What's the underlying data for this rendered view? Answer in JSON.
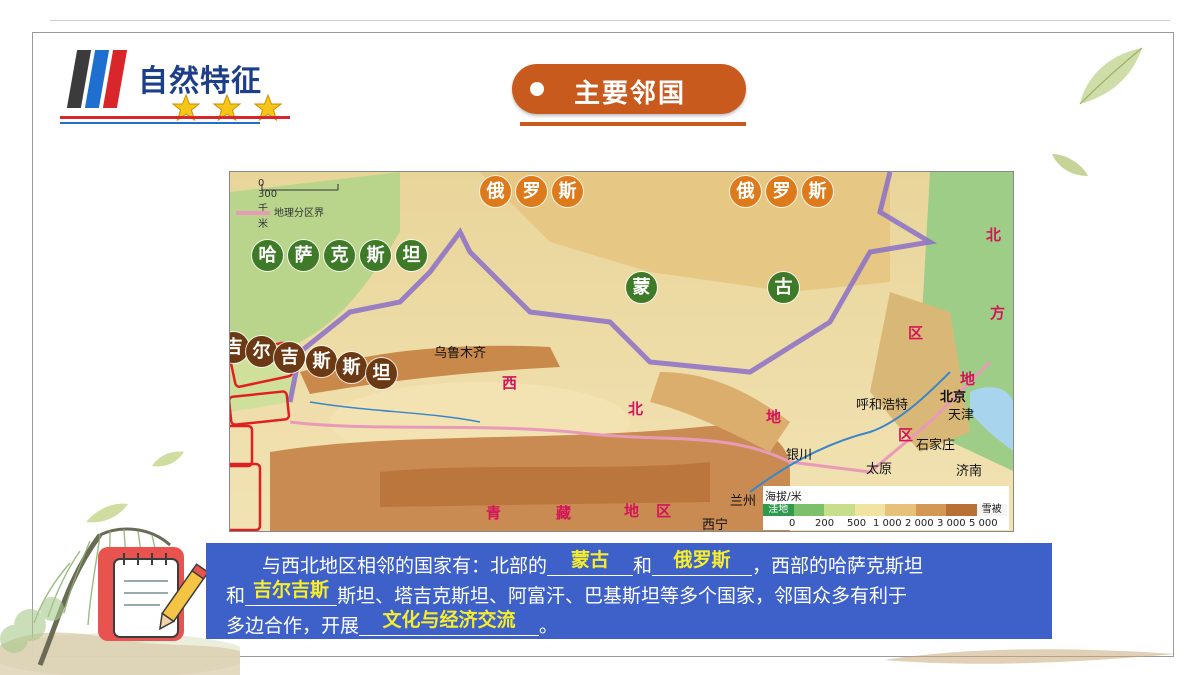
{
  "header": {
    "title": "自然特征",
    "section_label": "主要邻国"
  },
  "map": {
    "scale_label": "0      300 千米",
    "boundary_legend": "地理分区界",
    "neighbor_labels": {
      "russia": [
        "俄",
        "罗",
        "斯"
      ],
      "mongolia": [
        "蒙",
        "古"
      ],
      "kazakhstan": [
        "哈",
        "萨",
        "克",
        "斯",
        "坦"
      ],
      "kyrgyzstan": [
        "吉",
        "尔",
        "吉",
        "斯",
        "斯",
        "坦"
      ]
    },
    "cities": {
      "urumqi": "乌鲁木齐",
      "hohhot": "呼和浩特",
      "beijing": "北京",
      "tianjin": "天津",
      "shijiazhuang": "石家庄",
      "taiyuan": "太原",
      "jinan": "济南",
      "yinchuan": "银川",
      "lanzhou": "兰州",
      "xining": "西宁"
    },
    "regions": {
      "northwest": [
        "西",
        "北",
        "地",
        "区"
      ],
      "north": [
        "北",
        "方",
        "地",
        "区"
      ],
      "qinghai": [
        "青",
        "藏",
        "地",
        "区"
      ]
    },
    "elevation_legend": {
      "title": "海拔/米",
      "swatch_labels": [
        "洼地",
        "雪被"
      ],
      "ticks": [
        "0",
        "200",
        "500",
        "1 000",
        "2 000",
        "3 000",
        "5 000"
      ],
      "colors": [
        "#2f9a4d",
        "#7cc16a",
        "#c7df8d",
        "#f1e4a3",
        "#e7c07a",
        "#d39854",
        "#b97034",
        "#f4f4f4"
      ]
    }
  },
  "statement": {
    "line1_prefix": "与西北地区相邻的国家有：北部的",
    "answer_north1": "蒙古",
    "line1_mid": "和",
    "answer_north2": "俄罗斯",
    "line1_suffix": "，西部的哈萨克斯坦",
    "line2_prefix": "和",
    "answer_west": "吉尔吉斯",
    "line2_suffix": "斯坦、塔吉克斯坦、阿富汗、巴基斯坦等多个国家，邻国众多有利于",
    "line3_prefix": "多边合作，开展",
    "answer_coop": "文化与经济交流",
    "line3_suffix": "。"
  },
  "colors": {
    "accent_orange": "#c95a1e",
    "panel_blue": "#3e60c9",
    "answer_yellow": "#f6ee2a",
    "title_blue": "#1d3f8a"
  }
}
